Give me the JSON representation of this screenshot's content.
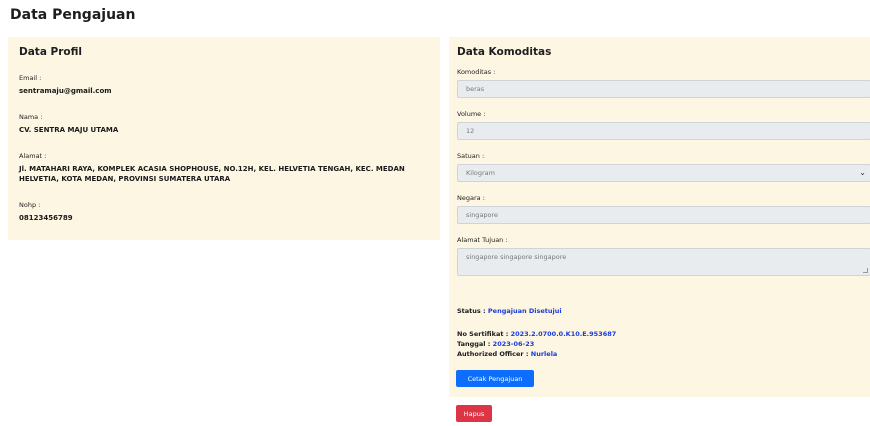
{
  "page_title": "Data Pengajuan",
  "profil": {
    "title": "Data Profil",
    "email_label": "Email :",
    "email_value": "sentramaju@gmail.com",
    "nama_label": "Nama :",
    "nama_value": "CV. SENTRA MAJU UTAMA",
    "alamat_label": "Alamat :",
    "alamat_line1": "Jl. MATAHARI RAYA, KOMPLEK ACASIA SHOPHOUSE, NO.12H, KEL. HELVETIA TENGAH, KEC. MEDAN",
    "alamat_line2": "HELVETIA, KOTA MEDAN, PROVINSI SUMATERA UTARA",
    "nohp_label": "Nohp :",
    "nohp_value": "08123456789"
  },
  "komoditas": {
    "title": "Data Komoditas",
    "komoditas_label": "Komoditas :",
    "komoditas_value": "beras",
    "volume_label": "Volume :",
    "volume_value": "12",
    "satuan_label": "Satuan :",
    "satuan_value": "Kilogram",
    "negara_label": "Negara :",
    "negara_value": "singapore",
    "alamat_tujuan_label": "Alamat Tujuan :",
    "alamat_tujuan_value": "singapore singapore singapore"
  },
  "status": {
    "status_label": "Status :",
    "status_value": "Pengajuan Disetujui",
    "sertifikat_label": "No Sertifikat :",
    "sertifikat_value": "2023.2.0700.0.K10.E.953687",
    "tanggal_label": "Tanggal :",
    "tanggal_value": "2023-06-23",
    "officer_label": "Authorized Officer :",
    "officer_value": "Nurlela"
  },
  "buttons": {
    "cetak": "Cetak Pengajuan",
    "hapus": "Hapus"
  },
  "colors": {
    "panel_bg": "#fdf6e3",
    "primary": "#0d6efd",
    "danger": "#dc3545",
    "link": "#1a3bd6"
  }
}
